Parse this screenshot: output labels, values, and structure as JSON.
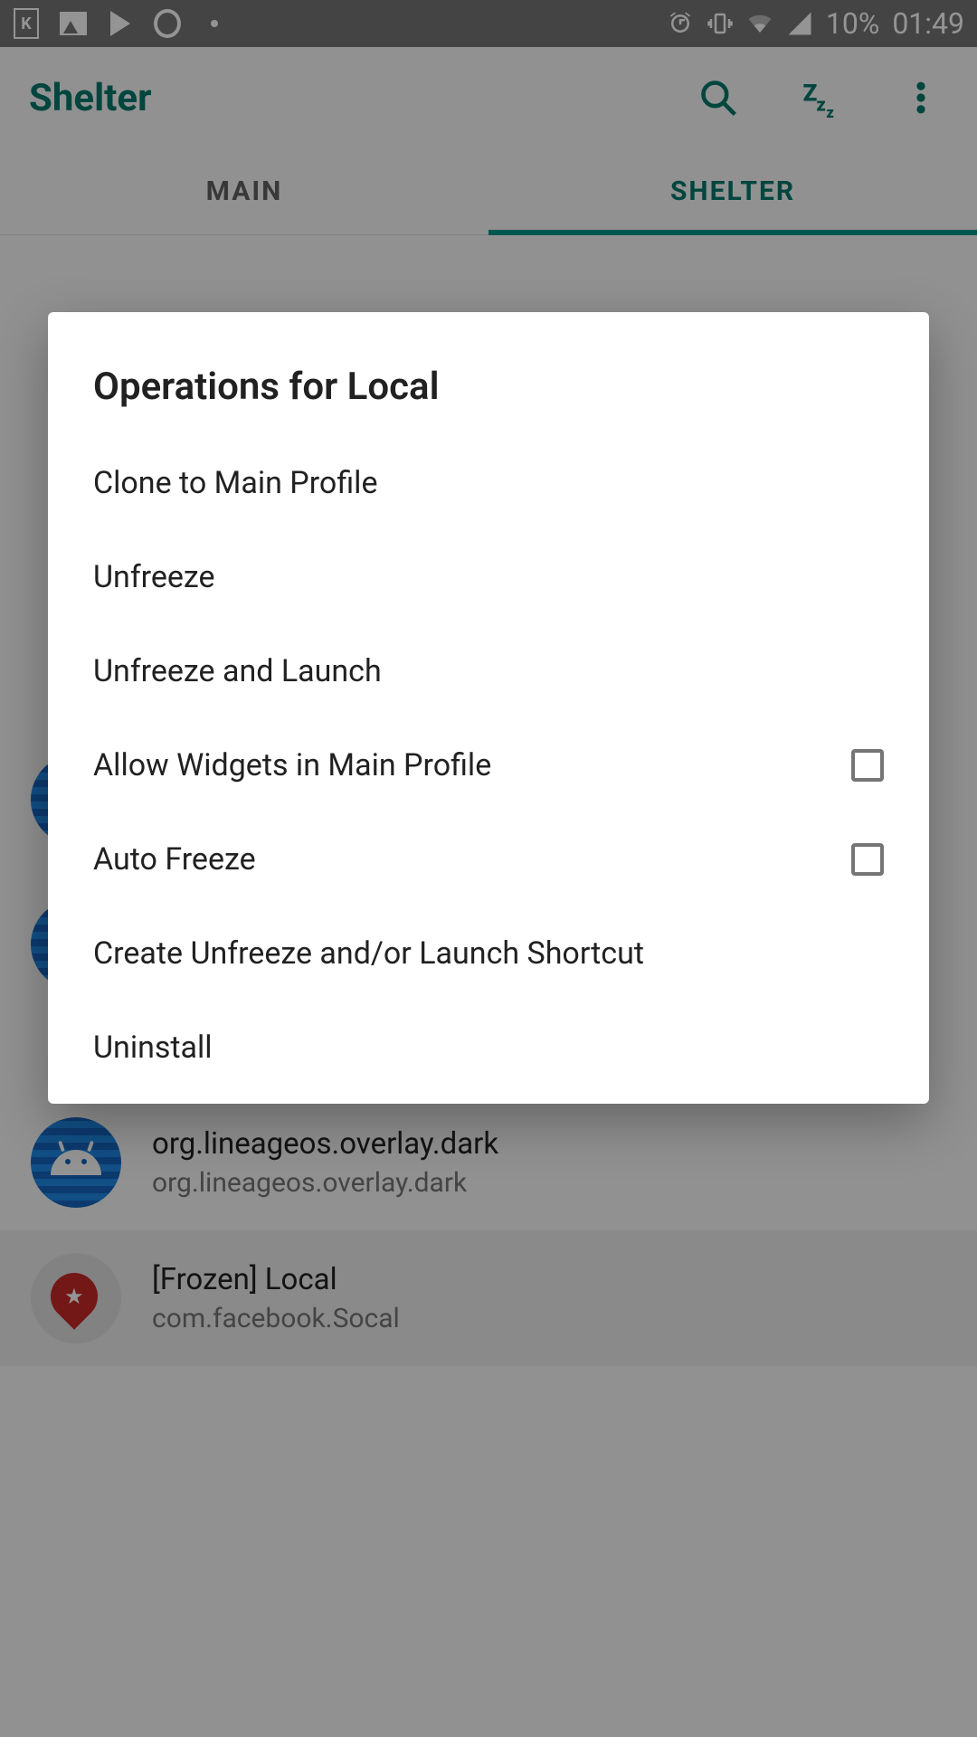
{
  "status_bar": {
    "battery_text": "10%",
    "clock": "01:49"
  },
  "app_bar": {
    "title": "Shelter"
  },
  "tabs": {
    "main": "MAIN",
    "shelter": "SHELTER"
  },
  "dialog": {
    "title": "Operations for Local",
    "items": {
      "clone": "Clone to Main Profile",
      "unfreeze": "Unfreeze",
      "unfreeze_launch": "Unfreeze and Launch",
      "allow_widgets": "Allow Widgets in Main Profile",
      "auto_freeze": "Auto Freeze",
      "create_shortcut": "Create Unfreeze and/or Launch Shortcut",
      "uninstall": "Uninstall"
    }
  },
  "apps": {
    "overlay_dark": {
      "label": "org.lineageos.overlay.dark",
      "package": "org.lineageos.overlay.dark"
    },
    "local": {
      "label": "[Frozen] Local",
      "package": "com.facebook.Socal"
    }
  }
}
